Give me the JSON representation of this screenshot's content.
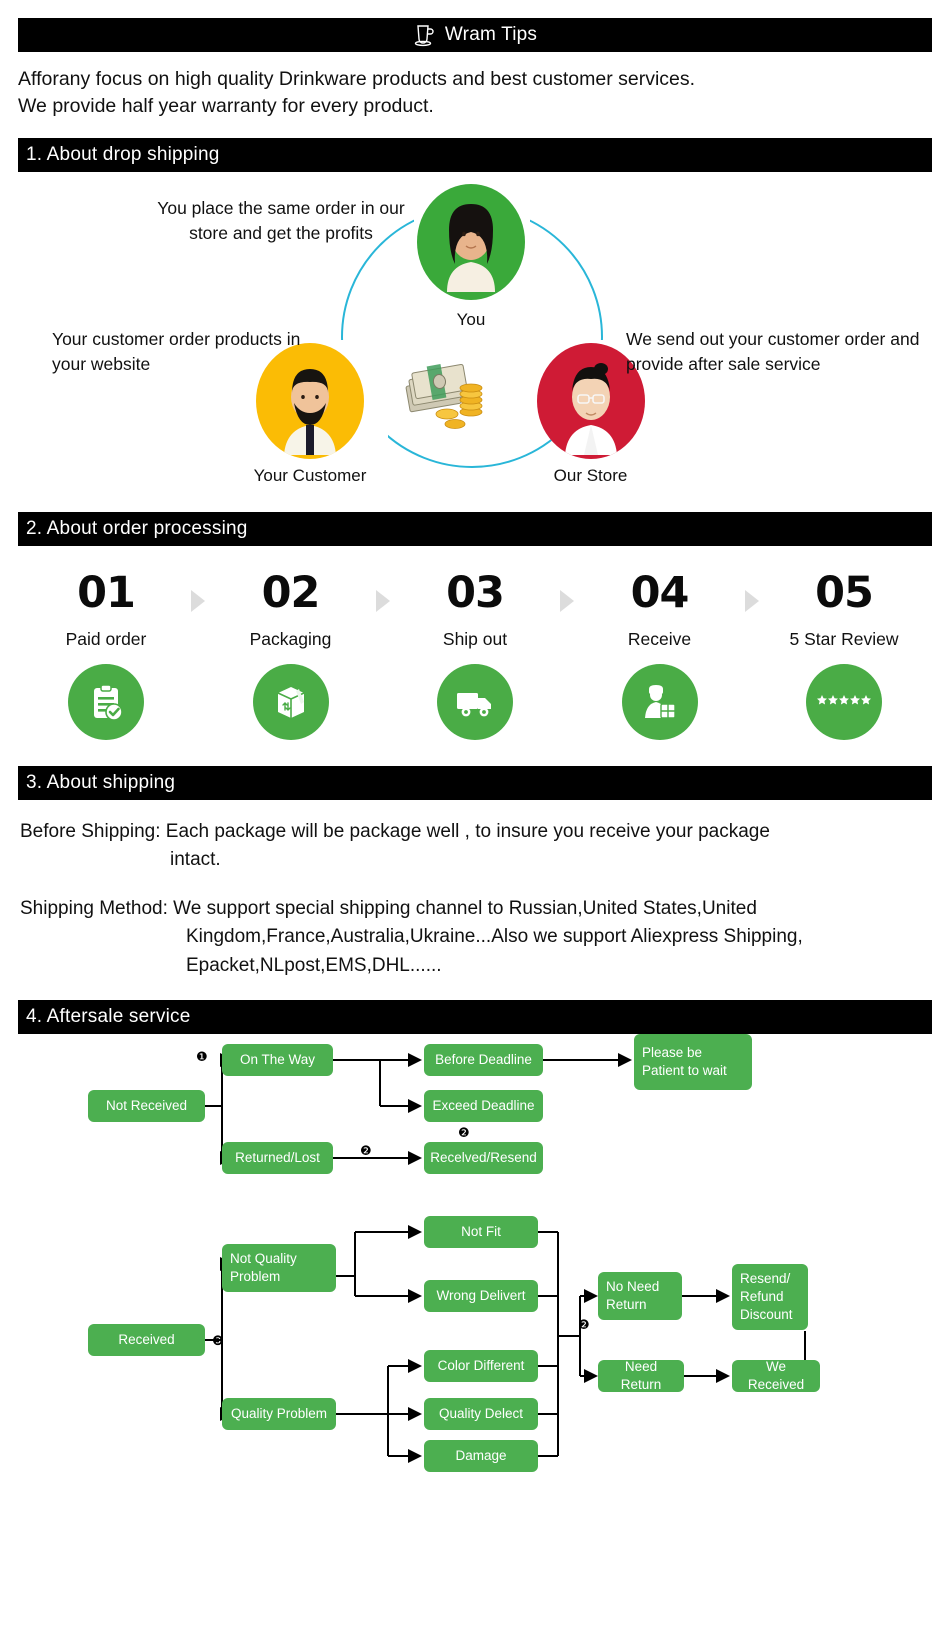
{
  "header": {
    "title": "Wram Tips",
    "icon": "cup-icon"
  },
  "intro": {
    "line1": "Afforany focus on high quality Drinkware products and best customer services.",
    "line2": "We provide half year warranty for every product."
  },
  "sections": {
    "dropshipping": {
      "bar_title": "1. About  drop shipping",
      "nodes": [
        {
          "id": "you",
          "label": "You",
          "color": "#3aa93a",
          "icon": "woman-avatar-icon"
        },
        {
          "id": "customer",
          "label": "Your Customer",
          "color": "#fbbc05",
          "icon": "man-avatar-icon"
        },
        {
          "id": "store",
          "label": "Our Store",
          "color": "#cf1b35",
          "icon": "clerk-avatar-icon"
        }
      ],
      "callouts": {
        "top": "You place the same order in our store and get the profits",
        "left": "Your customer order products in your website",
        "right": "We send out your customer order and provide after sale service"
      },
      "center_icon": "money-cash-coins-icon",
      "ring_color": "#29b6d8"
    },
    "order_processing": {
      "bar_title": "2. About  order processing",
      "arrow_icon": "triangle-right-icon",
      "steps": [
        {
          "num": "01",
          "label": "Paid order",
          "icon": "clipboard-check-icon"
        },
        {
          "num": "02",
          "label": "Packaging",
          "icon": "package-box-icon"
        },
        {
          "num": "03",
          "label": "Ship out",
          "icon": "delivery-truck-icon"
        },
        {
          "num": "04",
          "label": "Receive",
          "icon": "courier-parcel-icon"
        },
        {
          "num": "05",
          "label": "5 Star Review",
          "icon": "five-stars-icon"
        }
      ],
      "accent_color": "#4aac46"
    },
    "shipping": {
      "bar_title": "3. About  shipping",
      "before_shipping_label": "Before Shipping:",
      "before_shipping_text": " Each package will be package well , to insure you receive your package",
      "before_shipping_text2": "intact.",
      "shipping_method_label": "Shipping Method:",
      "shipping_method_text": " We support special shipping channel to Russian,United States,United",
      "shipping_method_text2": "Kingdom,France,Australia,Ukraine...Also we support Aliexpress Shipping,",
      "shipping_method_text3": "Epacket,NLpost,EMS,DHL......"
    },
    "aftersale": {
      "bar_title": "4. Aftersale service",
      "box_color": "#4caf50",
      "flow_not_received": {
        "root": "Not Received",
        "markers": [
          "❶",
          "❷",
          "❷"
        ],
        "boxes": {
          "on_the_way": "On The Way",
          "returned_lost": "Returned/Lost",
          "before_deadline": "Before Deadline",
          "exceed_deadline": "Exceed Deadline",
          "received_resend": "Recelved/Resend",
          "please_wait": "Please be\nPatient to wait"
        }
      },
      "flow_received": {
        "root": "Received",
        "markers": [
          "❸",
          "❷"
        ],
        "boxes": {
          "not_quality_problem": "Not Quality\nProblem",
          "quality_problem": "Quality Problem",
          "not_fit": "Not Fit",
          "wrong_delivery": "Wrong Delivert",
          "color_different": "Color Different",
          "quality_defect": "Quality Delect",
          "damage": "Damage",
          "no_need_return": "No Need\nReturn",
          "need_return": "Need Return",
          "resend_refund": "Resend/\nRefund\nDiscount",
          "we_received": "We Received"
        }
      }
    }
  }
}
